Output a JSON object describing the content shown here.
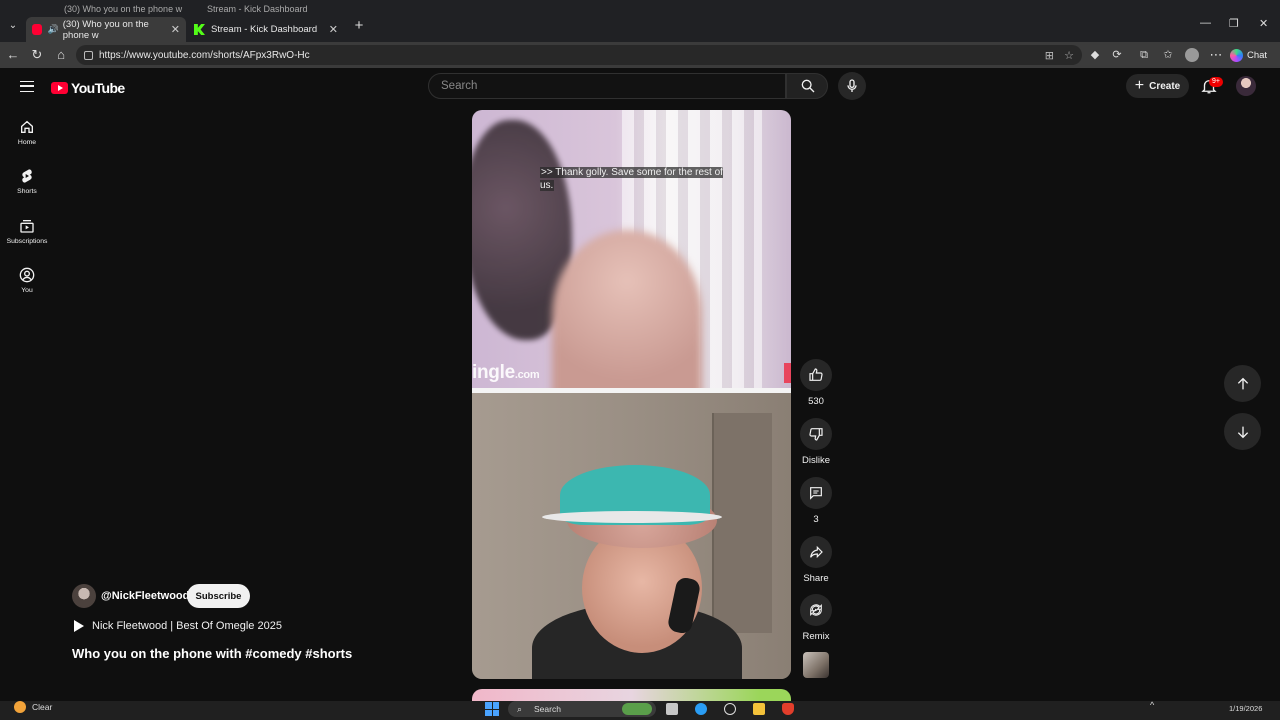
{
  "browser": {
    "ghost_tabs": [
      {
        "title": "(30) Who you on the phone w"
      },
      {
        "title": "Stream - Kick Dashboard"
      }
    ],
    "tabs": [
      {
        "title": "(30) Who you on the phone w",
        "favicon": "youtube-icon",
        "active": true
      },
      {
        "title": "Stream - Kick Dashboard",
        "favicon": "kick-icon",
        "active": false
      }
    ],
    "url": "https://www.youtube.com/shorts/AFpx3RwO-Hc",
    "chat_label": "Chat"
  },
  "yt": {
    "logo_text": "YouTube",
    "search_placeholder": "Search",
    "create_label": "Create",
    "notif_badge": "9+"
  },
  "rail": [
    {
      "label": "Home",
      "icon": "home-icon"
    },
    {
      "label": "Shorts",
      "icon": "shorts-icon"
    },
    {
      "label": "Subscriptions",
      "icon": "subscriptions-icon"
    },
    {
      "label": "You",
      "icon": "you-icon"
    }
  ],
  "video": {
    "caption": ">> Thank golly. Save some for the rest of us.",
    "watermark_main": "ingle",
    "watermark_dot": ".com"
  },
  "actions": {
    "like_count": "530",
    "dislike_label": "Dislike",
    "comment_count": "3",
    "share_label": "Share",
    "remix_label": "Remix"
  },
  "meta": {
    "channel": "@NickFleetwood",
    "subscribe_label": "Subscribe",
    "playlist": "Nick Fleetwood | Best Of Omegle 2025",
    "title": "Who you on the phone with #comedy #shorts"
  },
  "taskbar": {
    "weather": "Clear",
    "search": "Search",
    "date": "1/19/2026"
  },
  "colors": {
    "background": "#0f0f0f",
    "brand_red": "#ff0033",
    "button_bg": "#272727"
  }
}
